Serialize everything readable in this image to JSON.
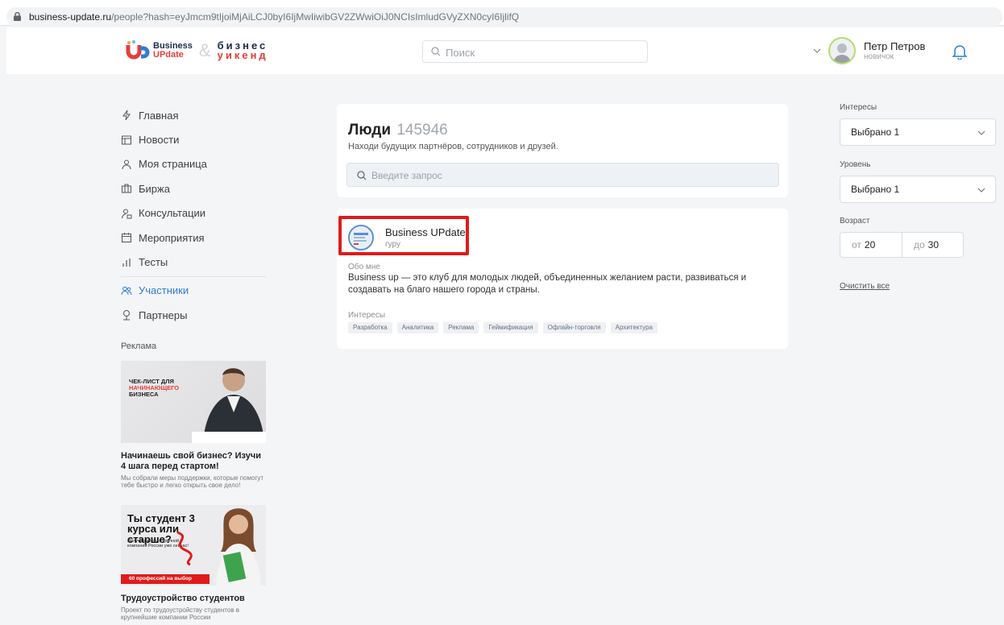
{
  "browser": {
    "url_host": "business-update.ru",
    "url_path": "/people?hash=eyJmcm9tIjoiMjAiLCJ0byI6IjMwIiwibGV2ZWwiOiJ0NCIsImludGVyZXN0cyI6IjlifQ"
  },
  "header": {
    "logo": {
      "line1": "Business",
      "line2": "UPdate",
      "amp": "&",
      "biz1": "бизнес",
      "biz2": "уикенд"
    },
    "search_placeholder": "Поиск",
    "user_name": "Петр Петров",
    "user_rank": "новичок"
  },
  "sidebar": {
    "items": [
      {
        "label": "Главная",
        "icon": "bolt-icon"
      },
      {
        "label": "Новости",
        "icon": "news-icon"
      },
      {
        "label": "Моя страница",
        "icon": "user-icon"
      },
      {
        "label": "Биржа",
        "icon": "briefcase-icon"
      },
      {
        "label": "Консультации",
        "icon": "consult-icon"
      },
      {
        "label": "Мероприятия",
        "icon": "calendar-icon"
      },
      {
        "label": "Тесты",
        "icon": "chart-icon"
      },
      {
        "label": "Участники",
        "icon": "people-icon",
        "active": true
      },
      {
        "label": "Партнеры",
        "icon": "handshake-icon"
      }
    ],
    "ads_title": "Реклама",
    "ads": [
      {
        "image_text": [
          "ЧЕК-ЛИСТ ДЛЯ",
          "НАЧИНАЮЩЕГО",
          "БИЗНЕСА"
        ],
        "title": "Начинаешь свой бизнес? Изучи 4 шага перед стартом!",
        "text": "Мы собрали меры поддержки, которые помогут тебе быстро и легко открыть свое дело!"
      },
      {
        "image_title": "Ты студент 3 курса или старше?",
        "image_sub": "Получи работу в крупной компании России уже сейчас!",
        "image_badge": "60 профессий на выбор",
        "title": "Трудоустройство студентов",
        "text": "Проект по трудоустройству студентов в крупнейшие компании России"
      }
    ]
  },
  "main": {
    "title": "Люди",
    "count": "145946",
    "subtitle": "Находи будущих партнёров, сотрудников и друзей.",
    "search_placeholder": "Введите запрос",
    "person": {
      "name": "Business UPdate",
      "rank": "гуру",
      "about_label": "Обо мне",
      "about_text": "Business up — это клуб для молодых людей, объединенных желанием расти, развиваться и создавать на благо нашего города и страны.",
      "interests_label": "Интересы",
      "tags": [
        "Разработка",
        "Аналитика",
        "Реклама",
        "Геймификация",
        "Офлайн-торговля",
        "Архитектура"
      ]
    }
  },
  "filters": {
    "interests_label": "Интересы",
    "interests_value": "Выбрано 1",
    "level_label": "Уровень",
    "level_value": "Выбрано 1",
    "age_label": "Возраст",
    "age_from_prefix": "от",
    "age_from": "20",
    "age_to_prefix": "до",
    "age_to": "30",
    "clear_label": "Очистить все"
  },
  "colors": {
    "accent": "#2f7cd6",
    "brand_red": "#e63c3c",
    "highlight": "#e01b1b"
  }
}
